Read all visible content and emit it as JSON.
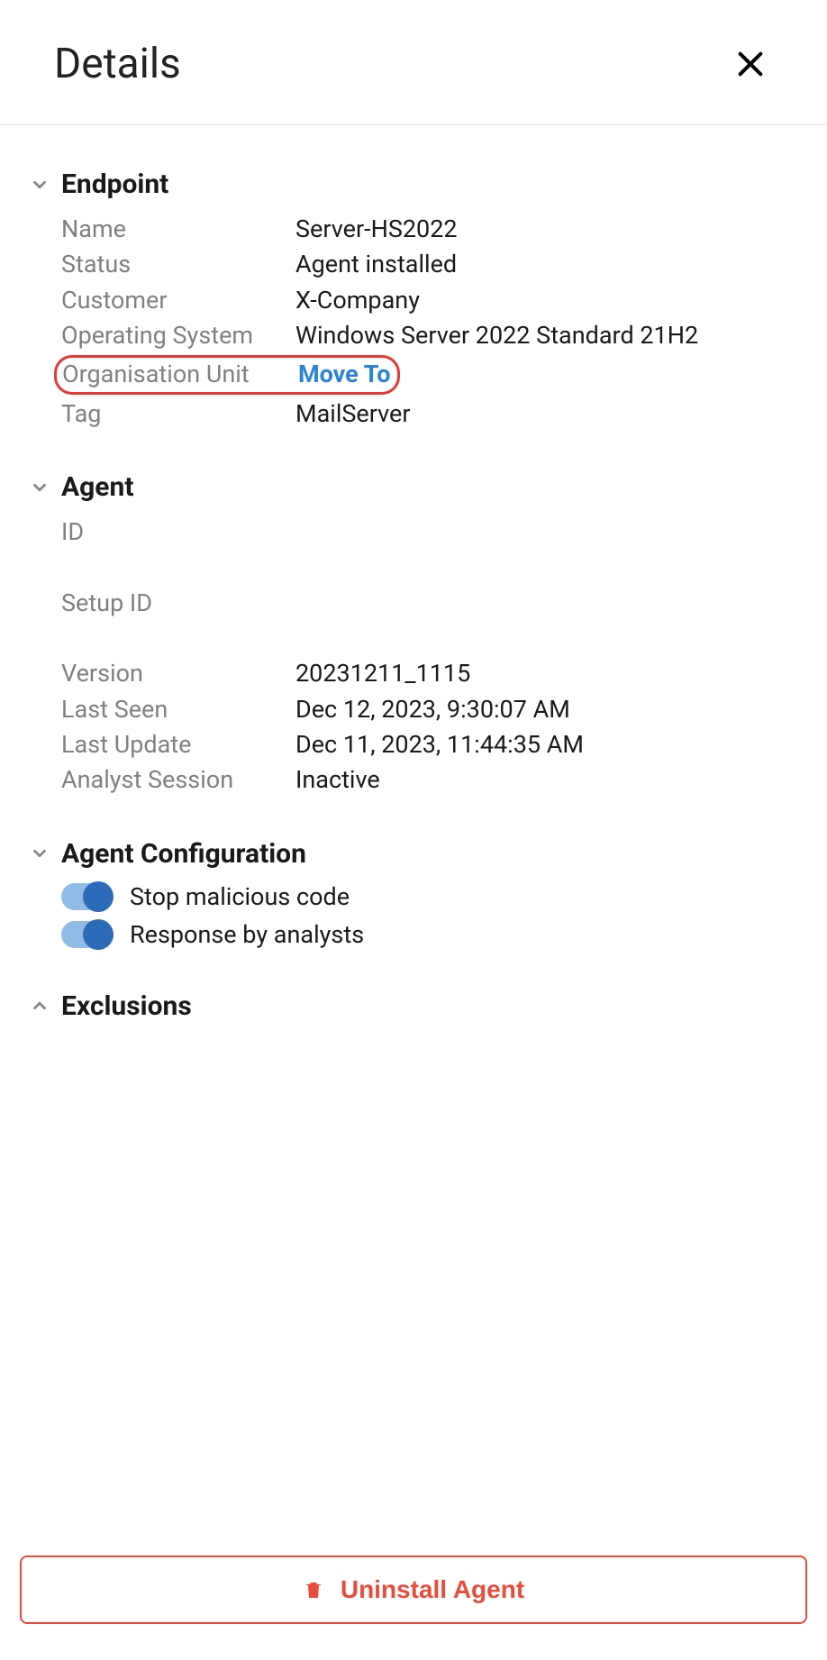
{
  "header": {
    "title": "Details"
  },
  "sections": {
    "endpoint": {
      "title": "Endpoint",
      "name_label": "Name",
      "name_value": "Server-HS2022",
      "status_label": "Status",
      "status_value": "Agent installed",
      "customer_label": "Customer",
      "customer_value": "X-Company",
      "os_label": "Operating System",
      "os_value": "Windows Server 2022 Standard 21H2",
      "org_unit_label": "Organisation Unit",
      "org_unit_action": "Move To",
      "tag_label": "Tag",
      "tag_value": "MailServer"
    },
    "agent": {
      "title": "Agent",
      "id_label": "ID",
      "id_value": "",
      "setup_id_label": "Setup ID",
      "setup_id_value": "",
      "version_label": "Version",
      "version_value": "20231211_1115",
      "last_seen_label": "Last Seen",
      "last_seen_value": "Dec 12, 2023, 9:30:07 AM",
      "last_update_label": "Last Update",
      "last_update_value": "Dec 11, 2023, 11:44:35 AM",
      "analyst_session_label": "Analyst Session",
      "analyst_session_value": "Inactive"
    },
    "agent_config": {
      "title": "Agent Configuration",
      "stop_malicious_label": "Stop malicious code",
      "response_analysts_label": "Response by analysts"
    },
    "exclusions": {
      "title": "Exclusions"
    }
  },
  "footer": {
    "uninstall_label": "Uninstall Agent"
  }
}
